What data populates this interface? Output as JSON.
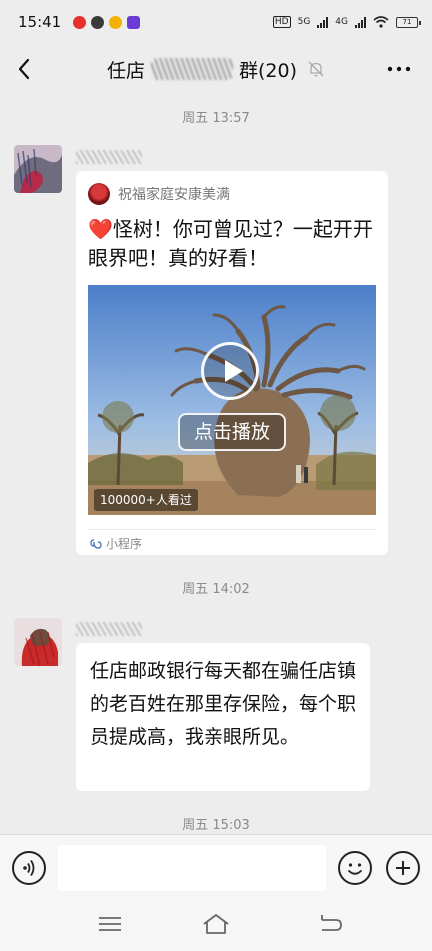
{
  "status": {
    "time": "15:41",
    "hd": "HD",
    "net_5g": "5G",
    "net_4g": "4G",
    "battery": "71"
  },
  "header": {
    "title_prefix": "任店",
    "title_suffix": "群(20)"
  },
  "messages": {
    "time_1": "周五 13:57",
    "card": {
      "source_name": "祝福家庭安康美满",
      "title_heart": "❤️",
      "title_text": "怪树！你可曾见过？一起开开眼界吧！真的好看！",
      "play_label": "点击播放",
      "views": "100000+人看过",
      "footer": "小程序"
    },
    "time_2": "周五 14:02",
    "text_message": "任店邮政银行每天都在骗任店镇的老百姓在那里存保险，每个职员提成高，我亲眼所见。",
    "time_3": "周五 15:03"
  },
  "icons": {
    "back": "back-arrow-icon",
    "mute": "mute-bell-icon",
    "more": "more-dots-icon",
    "voice": "voice-icon",
    "emoji": "emoji-icon",
    "plus": "plus-icon",
    "mini_program": "mini-program-icon"
  },
  "colors": {
    "background": "#ededed",
    "bubble": "#ffffff",
    "heart": "#e0322d"
  }
}
